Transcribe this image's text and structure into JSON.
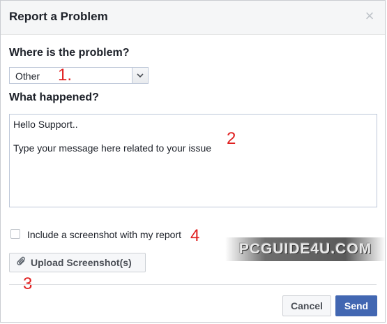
{
  "dialog": {
    "title": "Report a Problem",
    "close_icon": "close-icon"
  },
  "where": {
    "label": "Where is the problem?",
    "selected": "Other"
  },
  "what": {
    "label": "What happened?",
    "line1": "Hello Support..",
    "line2": "Type your message here related to your issue"
  },
  "screenshot": {
    "checkbox_label": "Include a screenshot with my report",
    "checked": false,
    "upload_label": "Upload Screenshot(s)"
  },
  "footer": {
    "cancel_label": "Cancel",
    "send_label": "Send"
  },
  "annotations": [
    "1.",
    "2",
    "3",
    "4"
  ],
  "watermark": "PCGUIDE4U.COM",
  "colors": {
    "annotation": "#e02020",
    "send_button": "#4267b2",
    "header_bg": "#f5f6f7"
  }
}
